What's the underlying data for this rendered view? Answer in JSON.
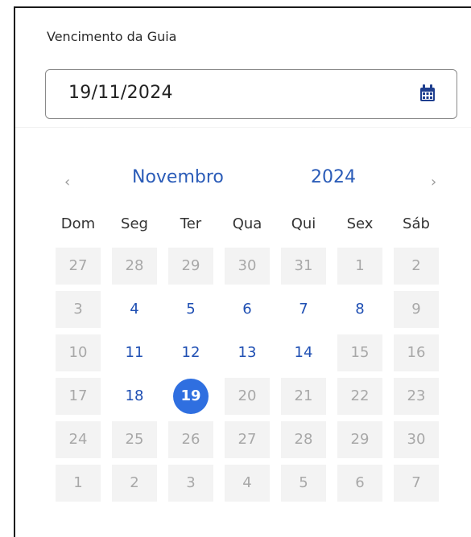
{
  "field": {
    "label": "Vencimento da Guia",
    "value": "19/11/2024",
    "icon": "calendar-icon"
  },
  "calendar": {
    "prev": "‹",
    "next": "›",
    "month": "Novembro",
    "year": "2024",
    "weekdays": [
      "Dom",
      "Seg",
      "Ter",
      "Qua",
      "Qui",
      "Sex",
      "Sáb"
    ],
    "weeks": [
      [
        {
          "d": "27",
          "s": "dim"
        },
        {
          "d": "28",
          "s": "dim"
        },
        {
          "d": "29",
          "s": "dim"
        },
        {
          "d": "30",
          "s": "dim"
        },
        {
          "d": "31",
          "s": "dim"
        },
        {
          "d": "1",
          "s": "dim"
        },
        {
          "d": "2",
          "s": "dim"
        }
      ],
      [
        {
          "d": "3",
          "s": "dim"
        },
        {
          "d": "4",
          "s": "active"
        },
        {
          "d": "5",
          "s": "active"
        },
        {
          "d": "6",
          "s": "active"
        },
        {
          "d": "7",
          "s": "active"
        },
        {
          "d": "8",
          "s": "active"
        },
        {
          "d": "9",
          "s": "dim"
        }
      ],
      [
        {
          "d": "10",
          "s": "dim"
        },
        {
          "d": "11",
          "s": "active"
        },
        {
          "d": "12",
          "s": "active"
        },
        {
          "d": "13",
          "s": "active"
        },
        {
          "d": "14",
          "s": "active"
        },
        {
          "d": "15",
          "s": "dim"
        },
        {
          "d": "16",
          "s": "dim"
        }
      ],
      [
        {
          "d": "17",
          "s": "dim"
        },
        {
          "d": "18",
          "s": "active"
        },
        {
          "d": "19",
          "s": "selected"
        },
        {
          "d": "20",
          "s": "dim"
        },
        {
          "d": "21",
          "s": "dim"
        },
        {
          "d": "22",
          "s": "dim"
        },
        {
          "d": "23",
          "s": "dim"
        }
      ],
      [
        {
          "d": "24",
          "s": "dim"
        },
        {
          "d": "25",
          "s": "dim"
        },
        {
          "d": "26",
          "s": "dim"
        },
        {
          "d": "27",
          "s": "dim"
        },
        {
          "d": "28",
          "s": "dim"
        },
        {
          "d": "29",
          "s": "dim"
        },
        {
          "d": "30",
          "s": "dim"
        }
      ],
      [
        {
          "d": "1",
          "s": "dim"
        },
        {
          "d": "2",
          "s": "dim"
        },
        {
          "d": "3",
          "s": "dim"
        },
        {
          "d": "4",
          "s": "dim"
        },
        {
          "d": "5",
          "s": "dim"
        },
        {
          "d": "6",
          "s": "dim"
        },
        {
          "d": "7",
          "s": "dim"
        }
      ]
    ]
  },
  "colors": {
    "accent": "#2f6fe0",
    "active_text": "#1f4fb3",
    "dim_bg": "#f3f3f3",
    "dim_text": "#a8a8a8"
  }
}
